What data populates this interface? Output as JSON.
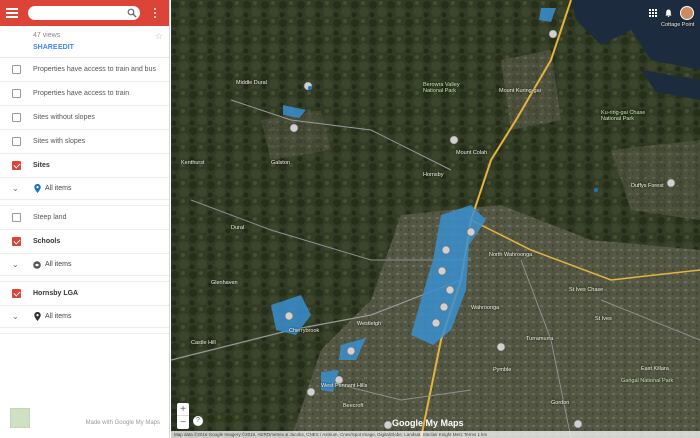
{
  "sidebar": {
    "search": {
      "value": "",
      "placeholder": ""
    },
    "views_text": "47 views",
    "share_label": "SHARE",
    "edit_label": "EDIT",
    "layers": [
      {
        "label": "Properties have access to train and bus",
        "checked": false,
        "bold": false
      },
      {
        "label": "Properties have access to train",
        "checked": false,
        "bold": false
      },
      {
        "label": "Sites without slopes",
        "checked": false,
        "bold": false
      },
      {
        "label": "Sites with slopes",
        "checked": false,
        "bold": false
      },
      {
        "label": "Sites",
        "checked": true,
        "bold": true,
        "sub": "All items",
        "icon": "location-pin-icon",
        "color": "#1e73be"
      },
      {
        "label": "Steep land",
        "checked": false,
        "bold": false
      },
      {
        "label": "Schools",
        "checked": true,
        "bold": true,
        "sub": "All items",
        "icon": "school-icon",
        "color": "#555555"
      },
      {
        "label": "Hornsby LGA",
        "checked": true,
        "bold": true,
        "sub": "All items",
        "icon": "location-pin-icon",
        "color": "#333333"
      }
    ],
    "footer_text": "Made with Google My Maps"
  },
  "map": {
    "labels": {
      "middle_dural": "Middle Dural",
      "berowra_valley": "Berowra Valley National Park",
      "mount_kuring_gai": "Mount Kuring-gai",
      "mount_colah": "Mount Colah",
      "hornsby": "Hornsby",
      "north_wahroonga": "North Wahroonga",
      "st_ives_chase": "St Ives Chase",
      "st_ives": "St Ives",
      "wahroonga": "Wahroonga",
      "westleigh": "Westleigh",
      "cherrybrook": "Cherrybrook",
      "castle_hill": "Castle Hill",
      "west_pennant_hills": "West Pennant Hills",
      "beecroft": "Beecroft",
      "turramurra": "Turramurra",
      "pymble": "Pymble",
      "east_killara": "East Killara",
      "gordon": "Gordon",
      "cottage_point": "Cottage Point",
      "duffys_forest": "Duffys Forest",
      "kenthurst": "Kenthurst",
      "galston": "Galston",
      "glenhaven": "Glenhaven",
      "dural": "Dural",
      "ku_ring_gai_park": "Ku-ring-gai Chase National Park",
      "garigal_park": "Garigal National Park"
    },
    "google_logo": "Google My Maps",
    "attribution": "Map data ©2016 Google Imagery ©2016, AEROmetrex & Jacobs, CNES / Astrium, Cnes/Spot Image, DigitalGlobe, Landsat, Sinclair Knight Merz    Terms    1 km",
    "zoom_in": "+",
    "zoom_out": "−",
    "help": "?",
    "colors": {
      "site": "#3a8fd0",
      "road": "#8f8f8f",
      "highway": "#e4b43f",
      "water": "#1d2b3e"
    }
  }
}
